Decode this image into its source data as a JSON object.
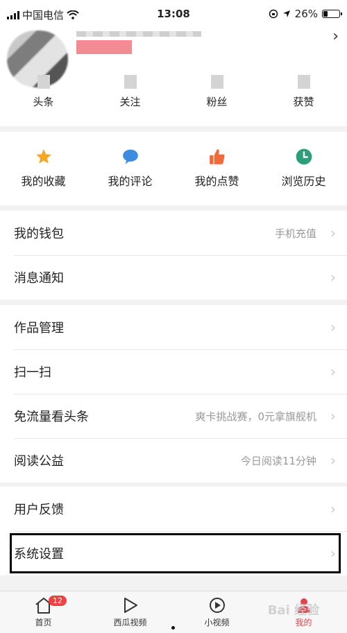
{
  "status_bar": {
    "carrier": "中国电信",
    "time": "13:08",
    "battery": "26%",
    "battery_level": 0.26
  },
  "profile": {
    "stats": [
      {
        "label": "头条"
      },
      {
        "label": "关注"
      },
      {
        "label": "粉丝"
      },
      {
        "label": "获赞"
      }
    ]
  },
  "quick_actions": [
    {
      "label": "我的收藏",
      "icon": "star-icon",
      "color": "#f5a623"
    },
    {
      "label": "我的评论",
      "icon": "comment-icon",
      "color": "#3c8dde"
    },
    {
      "label": "我的点赞",
      "icon": "thumbs-up-icon",
      "color": "#f06a3a"
    },
    {
      "label": "浏览历史",
      "icon": "clock-icon",
      "color": "#2e9e7a"
    }
  ],
  "menu": {
    "wallet": {
      "title": "我的钱包",
      "sub": "手机充值"
    },
    "notifications": {
      "title": "消息通知"
    },
    "works": {
      "title": "作品管理"
    },
    "scan": {
      "title": "扫一扫"
    },
    "free_data": {
      "title": "免流量看头条",
      "sub": "爽卡挑战赛，0元拿旗舰机"
    },
    "charity": {
      "title": "阅读公益",
      "sub": "今日阅读11分钟"
    },
    "feedback": {
      "title": "用户反馈"
    },
    "settings": {
      "title": "系统设置"
    }
  },
  "tabbar": {
    "tabs": [
      {
        "label": "首页",
        "badge": "12",
        "icon": "home-icon"
      },
      {
        "label": "西瓜视频",
        "icon": "play-icon"
      },
      {
        "label": "小视频",
        "icon": "short-video-icon"
      },
      {
        "label": "我的",
        "icon": "person-icon",
        "active": true
      }
    ],
    "watermark": "Bai 经验"
  },
  "colors": {
    "accent": "#e0454f",
    "badge": "#f04142"
  }
}
